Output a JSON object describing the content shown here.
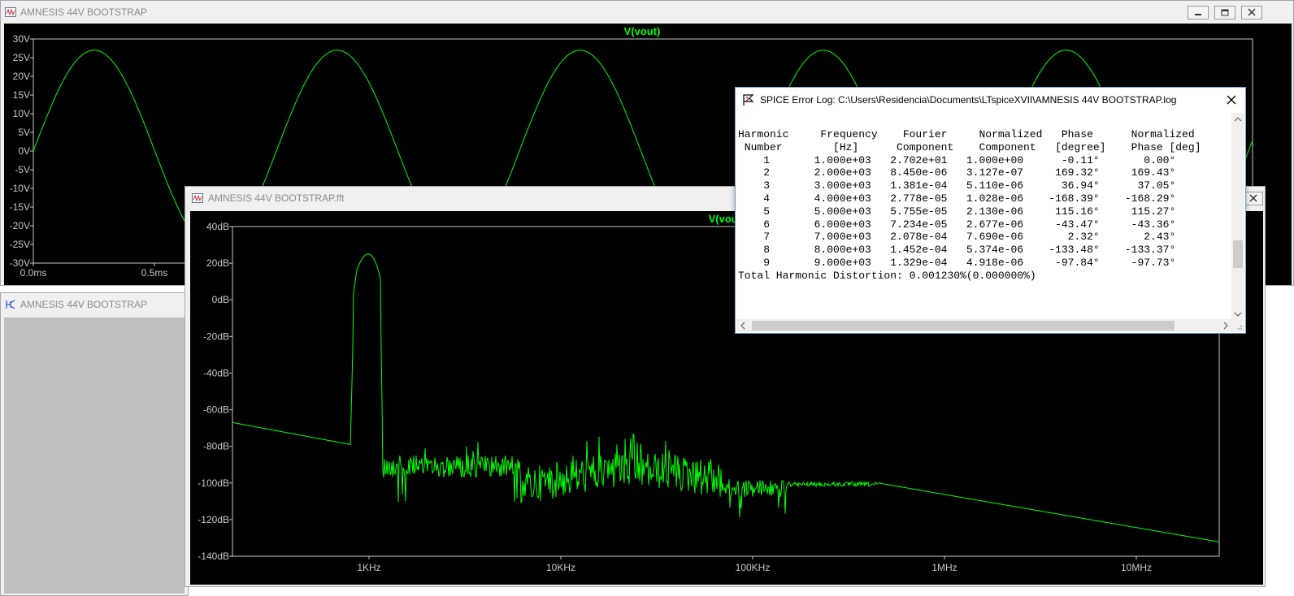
{
  "time_window": {
    "title": "AMNESIS 44V BOOTSTRAP",
    "trace": "V(vout)",
    "y_ticks": [
      "30V",
      "25V",
      "20V",
      "15V",
      "10V",
      "5V",
      "0V",
      "-5V",
      "-10V",
      "-15V",
      "-20V",
      "-25V",
      "-30V"
    ],
    "x_ticks": [
      "0.0ms",
      "0.5ms"
    ]
  },
  "schematic_window": {
    "title": "AMNESIS 44V BOOTSTRAP"
  },
  "fft_window": {
    "title": "AMNESIS 44V BOOTSTRAP.fft",
    "trace": "V(vout)",
    "y_ticks": [
      "40dB",
      "20dB",
      "0dB",
      "-20dB",
      "-40dB",
      "-60dB",
      "-80dB",
      "-100dB",
      "-120dB",
      "-140dB"
    ],
    "x_ticks": [
      "1KHz",
      "10KHz",
      "100KHz",
      "1MHz",
      "10MHz"
    ]
  },
  "log_window": {
    "title": "SPICE Error Log: C:\\Users\\Residencia\\Documents\\LTspiceXVII\\AMNESIS 44V BOOTSTRAP.log",
    "header1": "Harmonic     Frequency    Fourier     Normalized   Phase      Normalized",
    "header2": " Number        [Hz]      Component    Component   [degree]    Phase [deg]",
    "rows": [
      "    1       1.000e+03   2.702e+01   1.000e+00      -0.11°       0.00°",
      "    2       2.000e+03   8.450e-06   3.127e-07     169.32°     169.43°",
      "    3       3.000e+03   1.381e-04   5.110e-06      36.94°      37.05°",
      "    4       4.000e+03   2.778e-05   1.028e-06    -168.39°    -168.29°",
      "    5       5.000e+03   5.755e-05   2.130e-06     115.16°     115.27°",
      "    6       6.000e+03   7.234e-05   2.677e-06     -43.47°     -43.36°",
      "    7       7.000e+03   2.078e-04   7.690e-06       2.32°       2.43°",
      "    8       8.000e+03   1.452e-04   5.374e-06    -133.48°    -133.37°",
      "    9       9.000e+03   1.329e-04   4.918e-06     -97.84°     -97.73°"
    ],
    "thd": "Total Harmonic Distortion: 0.001230%(0.000000%)"
  },
  "colors": {
    "trace": "#00ff00",
    "plot_bg": "#000000",
    "grid_box": "#c8c8c8"
  }
}
